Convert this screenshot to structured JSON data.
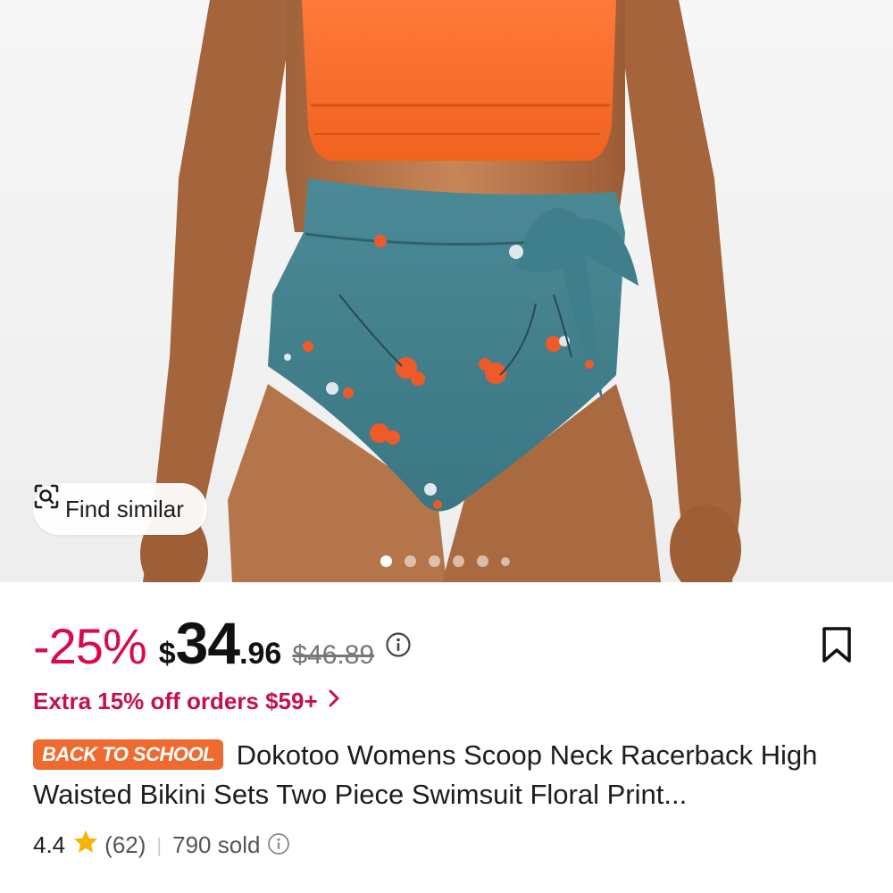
{
  "hero": {
    "find_similar_label": "Find similar",
    "carousel_dots": 6,
    "active_dot": 0
  },
  "pricing": {
    "discount": "-25%",
    "currency": "$",
    "price_integer": "34",
    "price_decimal": ".96",
    "original_price": "$46.89"
  },
  "promo": {
    "text": "Extra 15% off orders $59+",
    "arrow": "›"
  },
  "product": {
    "badge": "BACK TO SCHOOL",
    "title": "Dokotoo Womens Scoop Neck Racerback High Waisted Bikini Sets Two Piece Swimsuit Floral Print..."
  },
  "rating": {
    "score": "4.4",
    "count": "(62)",
    "separator": "|",
    "sold": "790 sold"
  },
  "colors": {
    "accent_pink": "#d70a53",
    "promo_pink": "#c5114a",
    "badge_orange": "#ef6a2f",
    "star_yellow": "#f6b300"
  },
  "icons": {
    "find_similar": "image-search-icon",
    "price_info": "info-icon",
    "bookmark": "bookmark-icon",
    "promo_arrow": "chevron-right-icon",
    "rating_star": "star-icon",
    "sold_info": "info-icon"
  }
}
